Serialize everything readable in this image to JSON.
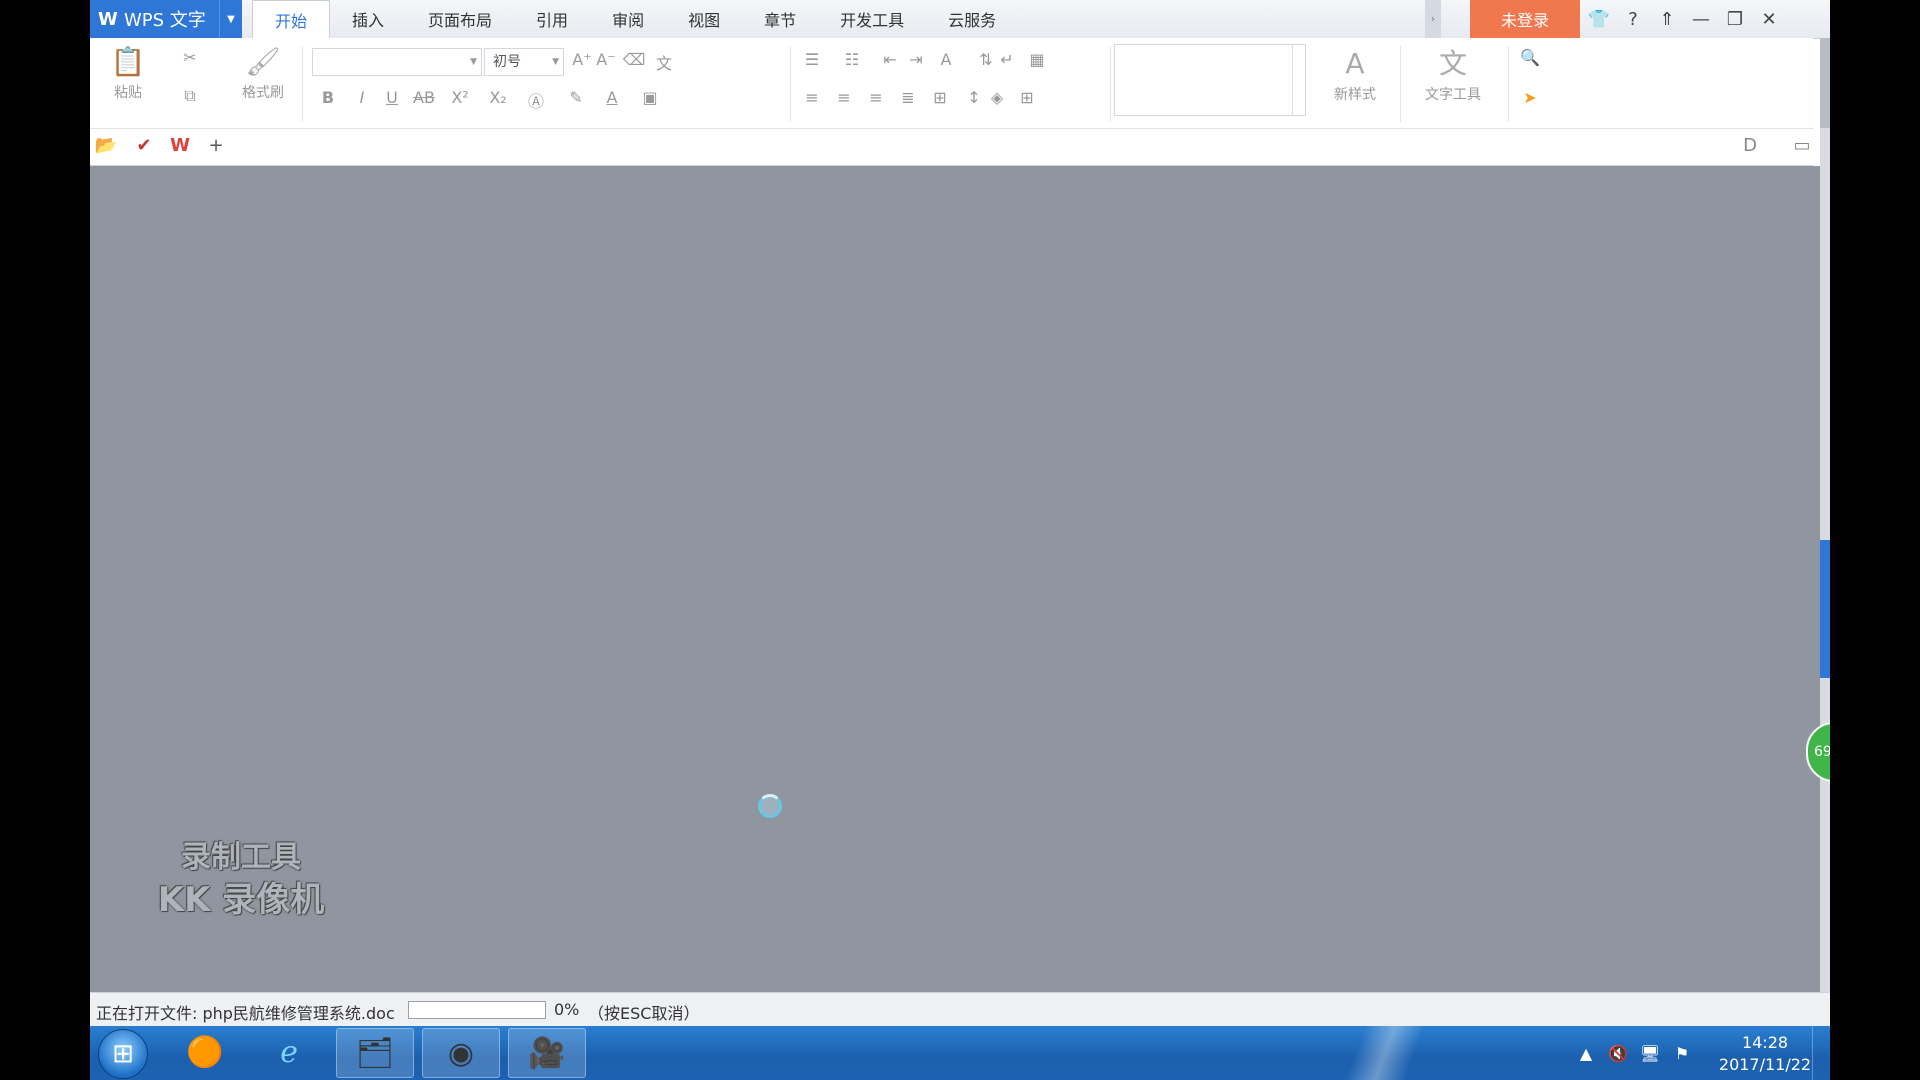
{
  "app": {
    "name": "WPS 文字",
    "logo": "W"
  },
  "tabs": [
    {
      "label": "开始"
    },
    {
      "label": "插入"
    },
    {
      "label": "页面布局"
    },
    {
      "label": "引用"
    },
    {
      "label": "审阅"
    },
    {
      "label": "视图"
    },
    {
      "label": "章节"
    },
    {
      "label": "开发工具"
    },
    {
      "label": "云服务"
    }
  ],
  "login_label": "未登录",
  "ribbon": {
    "paste_label": "粘贴",
    "format_painter_label": "格式刷",
    "font_name_value": "",
    "font_size_value": "初号",
    "new_style_label": "新样式",
    "text_tools_label": "文字工具"
  },
  "status": {
    "opening_text": "正在打开文件: php民航维修管理系统.doc",
    "progress_percent": 0,
    "progress_pct_label": "0%",
    "hint": "（按ESC取消）"
  },
  "watermark": {
    "line1": "录制工具",
    "line2": "KK 录像机"
  },
  "side_badge": "69",
  "clock": {
    "time": "14:28",
    "date": "2017/11/22"
  },
  "colors": {
    "accent": "#2f77d6",
    "login": "#f0774e",
    "doc_bg": "#8f969f"
  }
}
